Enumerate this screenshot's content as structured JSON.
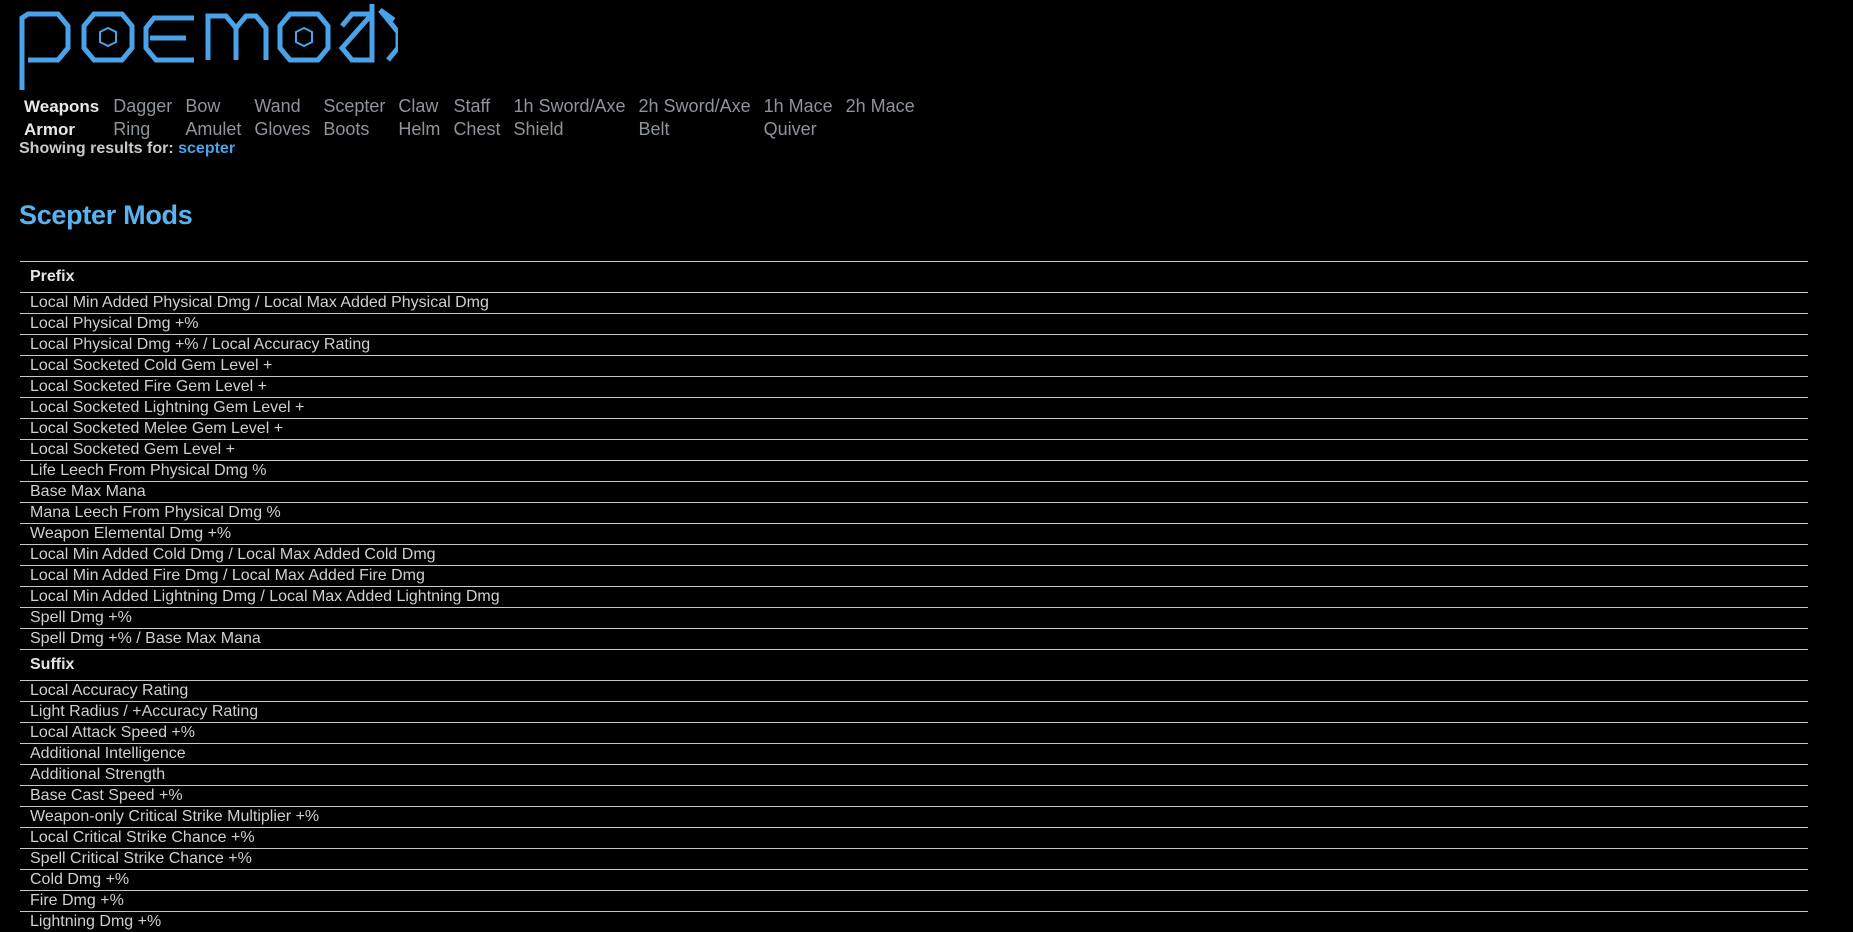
{
  "logo": {
    "text": "poemods",
    "color": "#4aa3e8"
  },
  "nav": {
    "rows": [
      {
        "category": "Weapons",
        "items": [
          "Dagger",
          "Bow",
          "Wand",
          "Scepter",
          "Claw",
          "Staff",
          "1h Sword/Axe",
          "2h Sword/Axe",
          "1h Mace",
          "2h Mace"
        ]
      },
      {
        "category": "Armor",
        "items": [
          "Ring",
          "Amulet",
          "Gloves",
          "Boots",
          "Helm",
          "Chest",
          "Shield",
          "Belt",
          "Quiver",
          ""
        ]
      }
    ]
  },
  "showing": {
    "label": "Showing results for:",
    "term": "scepter"
  },
  "page": {
    "title": "Scepter Mods"
  },
  "mods": {
    "prefix": {
      "label": "Prefix",
      "items": [
        "Local Min Added Physical Dmg / Local Max Added Physical Dmg",
        "Local Physical Dmg +%",
        "Local Physical Dmg +% / Local Accuracy Rating",
        "Local Socketed Cold Gem Level +",
        "Local Socketed Fire Gem Level +",
        "Local Socketed Lightning Gem Level +",
        "Local Socketed Melee Gem Level +",
        "Local Socketed Gem Level +",
        "Life Leech From Physical Dmg %",
        "Base Max Mana",
        "Mana Leech From Physical Dmg %",
        "Weapon Elemental Dmg +%",
        "Local Min Added Cold Dmg / Local Max Added Cold Dmg",
        "Local Min Added Fire Dmg / Local Max Added Fire Dmg",
        "Local Min Added Lightning Dmg / Local Max Added Lightning Dmg",
        "Spell Dmg +%",
        "Spell Dmg +% / Base Max Mana"
      ]
    },
    "suffix": {
      "label": "Suffix",
      "items": [
        "Local Accuracy Rating",
        "Light Radius / +Accuracy Rating",
        "Local Attack Speed +%",
        "Additional Intelligence",
        "Additional Strength",
        "Base Cast Speed +%",
        "Weapon-only Critical Strike Multiplier +%",
        "Local Critical Strike Chance +%",
        "Spell Critical Strike Chance +%",
        "Cold Dmg +%",
        "Fire Dmg +%",
        "Lightning Dmg +%"
      ]
    }
  }
}
